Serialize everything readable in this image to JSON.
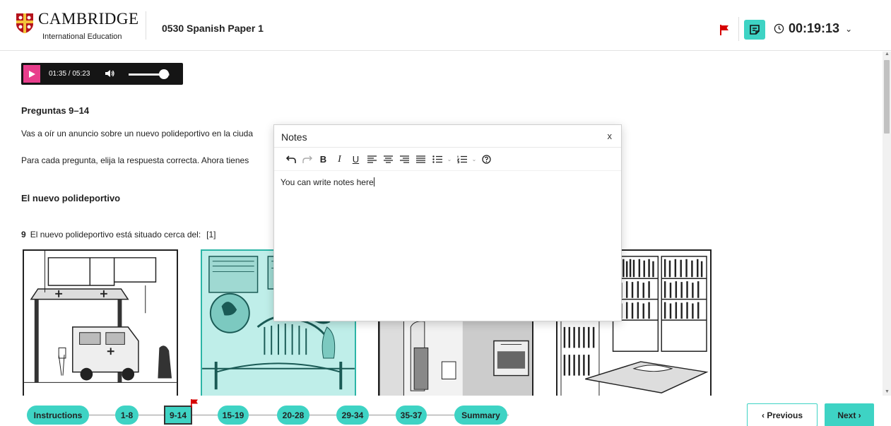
{
  "brand": {
    "name": "CAMBRIDGE",
    "sub": "International Education"
  },
  "paper_title": "0530 Spanish Paper 1",
  "timer": {
    "value": "00:19:13"
  },
  "audio": {
    "time": "01:35 / 05:23",
    "progress": 0.3
  },
  "section": {
    "heading": "Preguntas 9–14",
    "intro1": "Vas a oír un anuncio sobre un nuevo polideportivo en la ciuda",
    "intro2": "Para cada pregunta, elija la respuesta correcta. Ahora tienes",
    "title": "El nuevo polideportivo"
  },
  "question": {
    "number": "9",
    "text": "El nuevo polideportivo está situado cerca del:",
    "marks": "[1]"
  },
  "options": [
    {
      "name": "hospital",
      "selected": false
    },
    {
      "name": "museum",
      "selected": true
    },
    {
      "name": "building",
      "selected": false
    },
    {
      "name": "library",
      "selected": false
    }
  ],
  "notes": {
    "title": "Notes",
    "close": "x",
    "text": "You can write notes here"
  },
  "nav": {
    "items": [
      {
        "label": "Instructions"
      },
      {
        "label": "1-8"
      },
      {
        "label": "9-14",
        "active": true,
        "flagged": true
      },
      {
        "label": "15-19"
      },
      {
        "label": "20-28"
      },
      {
        "label": "29-34"
      },
      {
        "label": "35-37"
      },
      {
        "label": "Summary"
      }
    ],
    "previous": "‹ Previous",
    "next": "Next ›"
  },
  "colors": {
    "accent": "#3ed3c4",
    "flag": "#d60000",
    "play": "#e83e8c"
  }
}
